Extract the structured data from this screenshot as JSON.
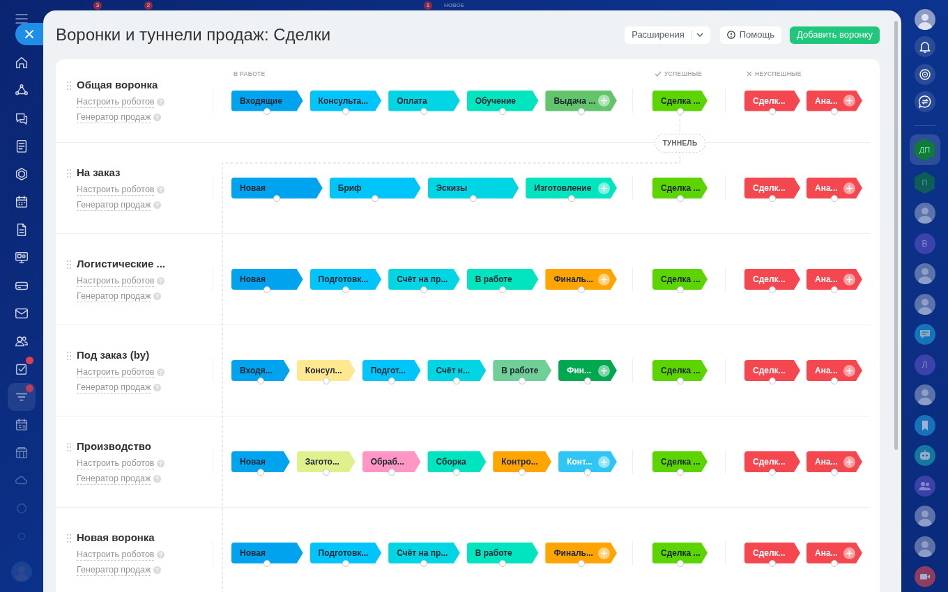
{
  "top_bar": {
    "counters": [
      "3",
      "2",
      "1"
    ],
    "label": "НОВОЕ"
  },
  "left_sidebar": {
    "items": [
      {
        "selected": false,
        "badge": false
      },
      {
        "selected": false,
        "badge": false
      },
      {
        "selected": false,
        "badge": false
      },
      {
        "selected": false,
        "badge": false
      },
      {
        "selected": false,
        "badge": false
      },
      {
        "selected": false,
        "badge": false
      },
      {
        "selected": false,
        "badge": false
      },
      {
        "selected": false,
        "badge": false
      },
      {
        "selected": false,
        "badge": false
      },
      {
        "selected": false,
        "badge": false
      },
      {
        "selected": false,
        "badge": false
      },
      {
        "selected": false,
        "badge": true
      },
      {
        "selected": true,
        "badge": true
      },
      {
        "selected": false,
        "badge": false
      },
      {
        "selected": false,
        "badge": false
      },
      {
        "selected": false,
        "badge": false
      },
      {
        "selected": false,
        "badge": false
      },
      {
        "selected": false,
        "badge": false
      }
    ]
  },
  "header": {
    "title": "Воронки и туннели продаж: Сделки",
    "buttons": [
      {
        "kind": "dropdown",
        "label": "Расширения"
      },
      {
        "kind": "help",
        "label": "Помощь"
      },
      {
        "kind": "primary",
        "label": "Добавить воронку"
      }
    ]
  },
  "columns": {
    "in_progress": "В РАБОТЕ",
    "success": "УСПЕШНЫЕ",
    "failure": "НЕУСПЕШНЫЕ"
  },
  "funnels": [
    {
      "name": "Общая воронка",
      "links": [
        "Настроить роботов",
        "Генератор продаж"
      ],
      "stages": [
        {
          "label": "Входящие",
          "color": "#00a3ee",
          "light_text": false
        },
        {
          "label": "Консульта...",
          "color": "#00c5fa",
          "light_text": false
        },
        {
          "label": "Оплата",
          "color": "#00d5e3",
          "light_text": false
        },
        {
          "label": "Обучение",
          "color": "#00e5c0",
          "light_text": false
        },
        {
          "label": "Выдача ...",
          "color": "#62c46b",
          "light_text": false
        }
      ],
      "success": [
        {
          "label": "Сделка ...",
          "color": "#5cd400",
          "light_text": false
        }
      ],
      "failure": [
        {
          "label": "Сделк...",
          "color": "#f5474f",
          "light_text": true
        },
        {
          "label": "Ана...",
          "color": "#f5474f",
          "light_text": true
        }
      ]
    },
    {
      "name": "На заказ",
      "links": [
        "Настроить роботов",
        "Генератор продаж"
      ],
      "stages": [
        {
          "label": "Новая",
          "color": "#00a3ee",
          "light_text": false
        },
        {
          "label": "Бриф",
          "color": "#00c5fa",
          "light_text": false
        },
        {
          "label": "Эскизы",
          "color": "#00d5e3",
          "light_text": false
        },
        {
          "label": "Изготовление",
          "color": "#00e5c0",
          "light_text": false
        }
      ],
      "success": [
        {
          "label": "Сделка ...",
          "color": "#5cd400",
          "light_text": false
        }
      ],
      "failure": [
        {
          "label": "Сделк...",
          "color": "#f5474f",
          "light_text": true
        },
        {
          "label": "Ана...",
          "color": "#f5474f",
          "light_text": true
        }
      ]
    },
    {
      "name": "Логистические ...",
      "links": [
        "Настроить роботов",
        "Генератор продаж"
      ],
      "stages": [
        {
          "label": "Новая",
          "color": "#00a3ee",
          "light_text": false
        },
        {
          "label": "Подготовк...",
          "color": "#00c5fa",
          "light_text": false
        },
        {
          "label": "Счёт на пр...",
          "color": "#00d5e3",
          "light_text": false
        },
        {
          "label": "В работе",
          "color": "#00e5c0",
          "light_text": false
        },
        {
          "label": "Финаль...",
          "color": "#ffa400",
          "light_text": false
        }
      ],
      "success": [
        {
          "label": "Сделка ...",
          "color": "#5cd400",
          "light_text": false
        }
      ],
      "failure": [
        {
          "label": "Сделк...",
          "color": "#f5474f",
          "light_text": true
        },
        {
          "label": "Ана...",
          "color": "#f5474f",
          "light_text": true
        }
      ]
    },
    {
      "name": "Под заказ (by)",
      "links": [
        "Настроить роботов",
        "Генератор продаж"
      ],
      "stages": [
        {
          "label": "Входя...",
          "color": "#00a3ee",
          "light_text": false
        },
        {
          "label": "Консул...",
          "color": "#ffe88f",
          "light_text": false
        },
        {
          "label": "Подгот...",
          "color": "#00c5fa",
          "light_text": false
        },
        {
          "label": "Счёт н...",
          "color": "#00d5e3",
          "light_text": false
        },
        {
          "label": "В работе",
          "color": "#6fcf97",
          "light_text": false
        },
        {
          "label": "Фин...",
          "color": "#00a84f",
          "light_text": true
        }
      ],
      "success": [
        {
          "label": "Сделка ...",
          "color": "#5cd400",
          "light_text": false
        }
      ],
      "failure": [
        {
          "label": "Сделк...",
          "color": "#f5474f",
          "light_text": true
        },
        {
          "label": "Ана...",
          "color": "#f5474f",
          "light_text": true
        }
      ]
    },
    {
      "name": "Производство",
      "links": [
        "Настроить роботов",
        "Генератор продаж"
      ],
      "stages": [
        {
          "label": "Новая",
          "color": "#00a3ee",
          "light_text": false
        },
        {
          "label": "Загото...",
          "color": "#e0f08d",
          "light_text": false
        },
        {
          "label": "Обраб...",
          "color": "#ff96c4",
          "light_text": false
        },
        {
          "label": "Сборка",
          "color": "#00e5c0",
          "light_text": false
        },
        {
          "label": "Контро...",
          "color": "#ffa400",
          "light_text": false
        },
        {
          "label": "Конт...",
          "color": "#2fc6f6",
          "light_text": true
        }
      ],
      "success": [
        {
          "label": "Сделка ...",
          "color": "#5cd400",
          "light_text": false
        }
      ],
      "failure": [
        {
          "label": "Сделк...",
          "color": "#f5474f",
          "light_text": true
        },
        {
          "label": "Ана...",
          "color": "#f5474f",
          "light_text": true
        }
      ]
    },
    {
      "name": "Новая воронка",
      "links": [
        "Настроить роботов",
        "Генератор продаж"
      ],
      "stages": [
        {
          "label": "Новая",
          "color": "#00a3ee",
          "light_text": false
        },
        {
          "label": "Подготовк...",
          "color": "#00c5fa",
          "light_text": false
        },
        {
          "label": "Счёт на пр...",
          "color": "#00d5e3",
          "light_text": false
        },
        {
          "label": "В работе",
          "color": "#00e5c0",
          "light_text": false
        },
        {
          "label": "Финаль...",
          "color": "#ffa400",
          "light_text": false
        }
      ],
      "success": [
        {
          "label": "Сделка ...",
          "color": "#5cd400",
          "light_text": false
        }
      ],
      "failure": [
        {
          "label": "Сделк...",
          "color": "#f5474f",
          "light_text": true
        },
        {
          "label": "Ана...",
          "color": "#f5474f",
          "light_text": true
        }
      ]
    }
  ],
  "tunnel": {
    "label": "ТУННЕЛЬ"
  },
  "right_sidebar": {
    "items": [
      {
        "kind": "avatar",
        "selected": false
      },
      {
        "kind": "icon",
        "selected": false
      },
      {
        "kind": "icon",
        "selected": false
      },
      {
        "kind": "icon",
        "selected": false
      },
      {
        "kind": "group",
        "text": "ДП",
        "selected": true
      },
      {
        "kind": "group",
        "text": "П",
        "selected": false
      },
      {
        "kind": "avatar",
        "selected": false
      },
      {
        "kind": "letter",
        "text": "В",
        "selected": false
      },
      {
        "kind": "avatar",
        "selected": false
      },
      {
        "kind": "avatar",
        "selected": false
      },
      {
        "kind": "icon",
        "selected": false
      },
      {
        "kind": "letter",
        "text": "Л",
        "selected": false
      },
      {
        "kind": "avatar",
        "selected": false
      },
      {
        "kind": "icon",
        "selected": false
      },
      {
        "kind": "icon",
        "selected": false
      },
      {
        "kind": "icon",
        "selected": false
      },
      {
        "kind": "avatar",
        "selected": false
      },
      {
        "kind": "avatar",
        "selected": false
      },
      {
        "kind": "icon",
        "selected": false
      }
    ]
  }
}
